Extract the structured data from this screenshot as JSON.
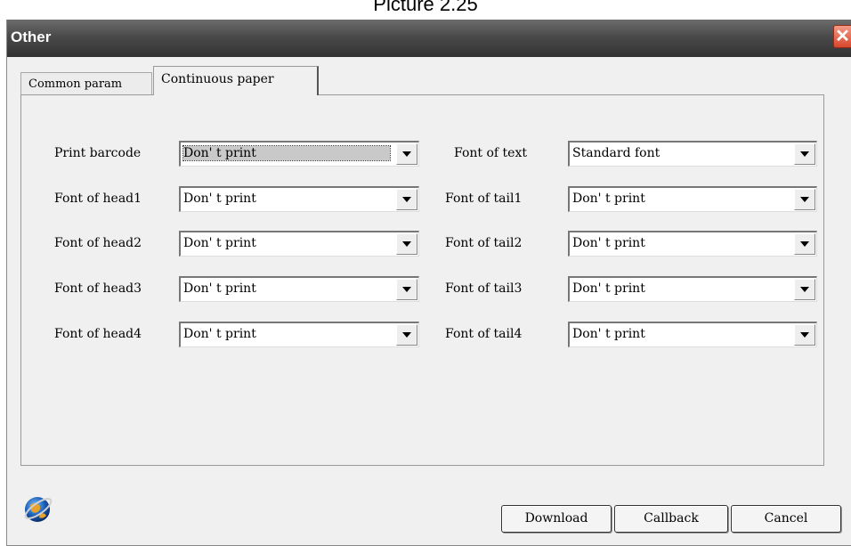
{
  "caption": "Picture 2.25",
  "window": {
    "title": "Other",
    "close_label": "✕"
  },
  "tabs": [
    {
      "label": "Common param",
      "active": false
    },
    {
      "label": "Continuous paper",
      "active": true
    }
  ],
  "form": {
    "left": [
      {
        "label": "Print barcode",
        "value": "Don' t print"
      },
      {
        "label": "Font of head1",
        "value": "Don' t print"
      },
      {
        "label": "Font of head2",
        "value": "Don' t print"
      },
      {
        "label": "Font of head3",
        "value": "Don' t print"
      },
      {
        "label": "Font of head4",
        "value": "Don' t print"
      }
    ],
    "right": [
      {
        "label": "Font of text",
        "value": "Standard font"
      },
      {
        "label": "Font of tail1",
        "value": "Don' t print"
      },
      {
        "label": "Font of tail2",
        "value": "Don' t print"
      },
      {
        "label": "Font of tail3",
        "value": "Don' t print"
      },
      {
        "label": "Font of tail4",
        "value": "Don' t print"
      }
    ]
  },
  "buttons": {
    "download": "Download",
    "callback": "Callback",
    "cancel": "Cancel"
  },
  "icons": {
    "logo": "globe-logo-icon",
    "close": "close-icon",
    "dropdown": "chevron-down-icon"
  },
  "colors": {
    "titlebar": "#4a4a4a",
    "close": "#d8472c",
    "dialog_bg": "#f0f0f0"
  }
}
